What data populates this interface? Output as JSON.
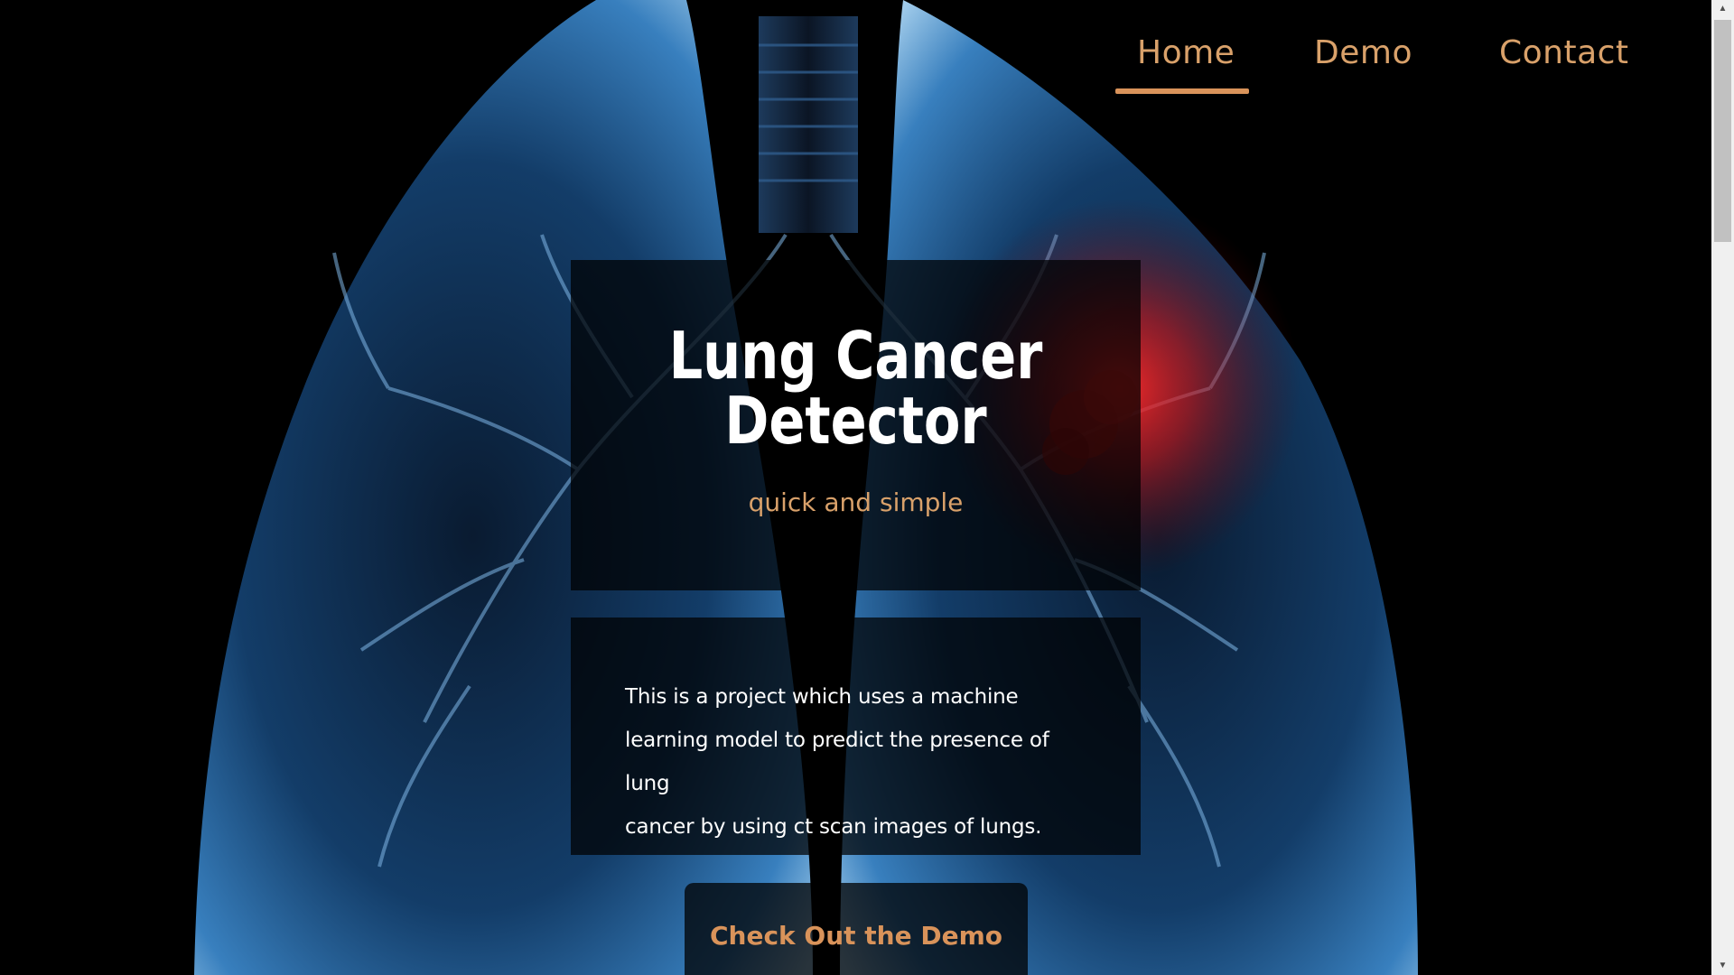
{
  "nav": {
    "items": [
      {
        "label": "Home"
      },
      {
        "label": "Demo"
      },
      {
        "label": "Contact"
      }
    ],
    "active": "Home"
  },
  "hero": {
    "title_line1": "Lung Cancer",
    "title_line2": "Detector",
    "subtitle": "quick and simple"
  },
  "description": {
    "line1": "This is a project which uses a machine",
    "line2": "learning model to predict the presence of lung",
    "line3": "cancer by using ct scan images of lungs."
  },
  "cta": {
    "label": "Check Out the Demo"
  },
  "colors": {
    "accent": "#d9a16a",
    "background": "#000000",
    "text": "#ffffff",
    "lung_blue": "#6fb0e6",
    "tumor_red": "#e02020"
  }
}
